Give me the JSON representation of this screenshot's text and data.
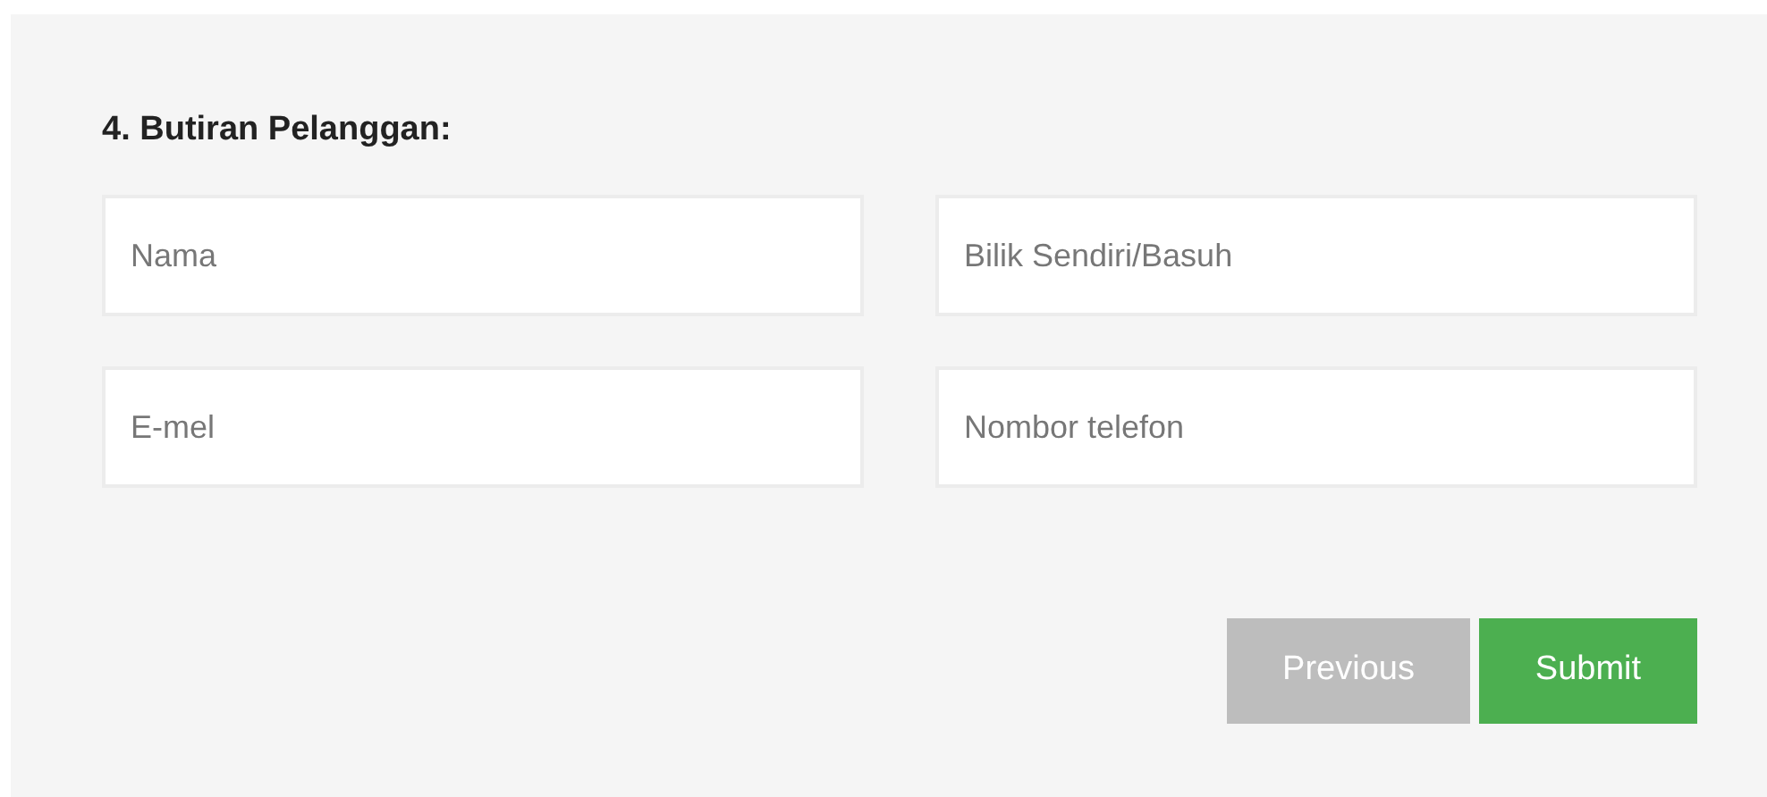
{
  "form": {
    "heading": "4. Butiran Pelanggan:",
    "fields": [
      {
        "placeholder": "Nama"
      },
      {
        "placeholder": "Bilik Sendiri/Basuh"
      },
      {
        "placeholder": "E-mel"
      },
      {
        "placeholder": "Nombor telefon"
      }
    ],
    "buttons": [
      {
        "label": "Previous",
        "kind": "secondary"
      },
      {
        "label": "Submit",
        "kind": "primary"
      }
    ]
  }
}
